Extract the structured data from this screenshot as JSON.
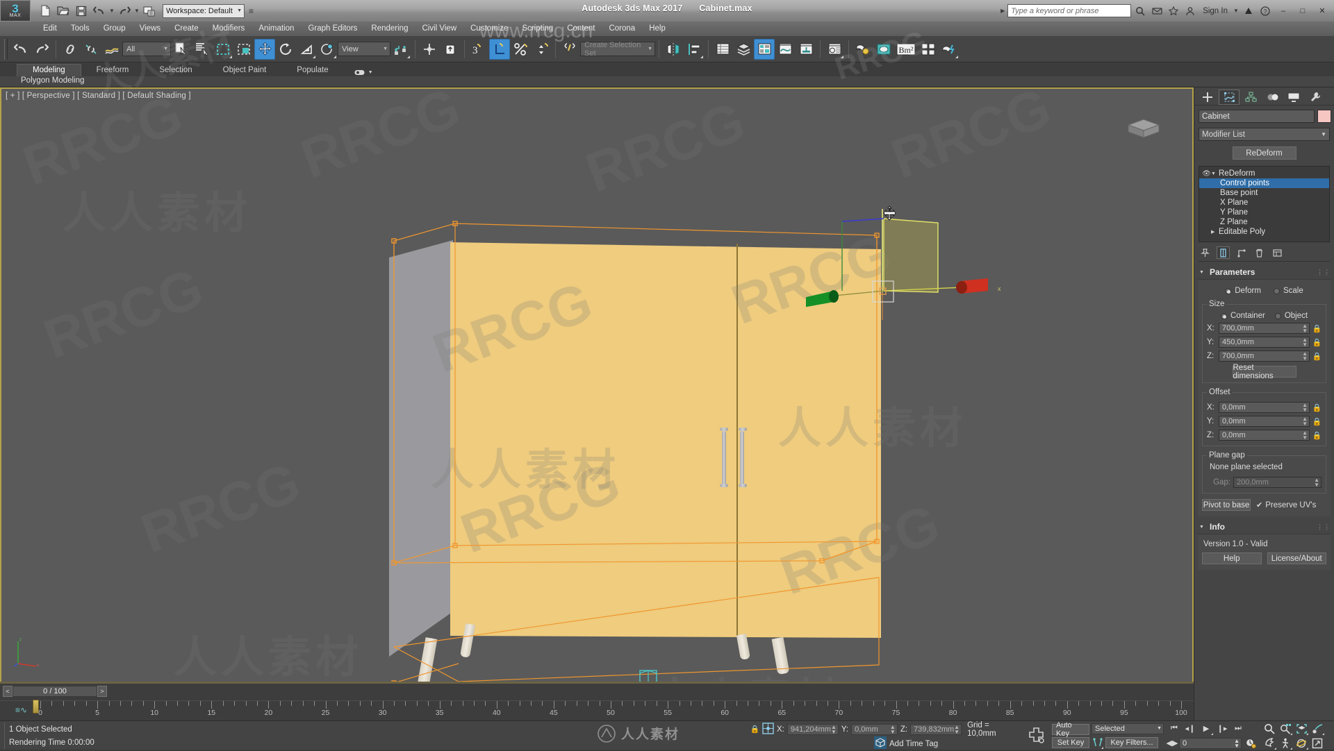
{
  "app": {
    "title_product": "Autodesk 3ds Max 2017",
    "title_file": "Cabinet.max",
    "workspace": "Workspace: Default",
    "search_placeholder": "Type a keyword or phrase",
    "sign_in": "Sign In",
    "logo_big": "3",
    "logo_small": "MAX",
    "window_buttons": [
      "—",
      "❐",
      "✕"
    ]
  },
  "menu": [
    "Edit",
    "Tools",
    "Group",
    "Views",
    "Create",
    "Modifiers",
    "Animation",
    "Graph Editors",
    "Rendering",
    "Civil View",
    "Customize",
    "Scripting",
    "Content",
    "Corona",
    "Help"
  ],
  "toolbar": {
    "selection_filter": "All",
    "reference_coord": "View",
    "selection_set_placeholder": "Create Selection Set",
    "icons": [
      "undo-icon",
      "redo-icon",
      "select-link-icon",
      "unlink-icon",
      "bind-space-warp-icon",
      "select-object-icon",
      "select-by-name-icon",
      "rectangular-select-icon",
      "window-crossing-icon",
      "select-and-move-icon",
      "select-and-rotate-icon",
      "select-and-scale-icon",
      "placement-icon",
      "use-pivot-center-icon",
      "select-and-manipulate-icon",
      "snaps-toggle-icon",
      "angle-snap-icon",
      "percent-snap-icon",
      "spinner-snap-icon",
      "named-selection-sets-icon",
      "mirror-icon",
      "align-icon",
      "layer-manager-icon",
      "scene-explorer-icon",
      "ribbon-toggle-icon",
      "curve-editor-icon",
      "schematic-view-icon",
      "material-editor-icon",
      "render-setup-icon",
      "render-frame-window-icon",
      "render-production-icon",
      "render-bitmap-icon",
      "render-iterative-icon",
      "active-shade-icon"
    ]
  },
  "ribbon": {
    "tabs": [
      "Modeling",
      "Freeform",
      "Selection",
      "Object Paint",
      "Populate"
    ],
    "active_tab": "Modeling",
    "panel_label": "Polygon Modeling"
  },
  "viewport": {
    "label": "[ + ] [ Perspective ] [ Standard ] [ Default Shading ]",
    "cabinet_front_color": "#efcc7e",
    "cabinet_side_color": "#9a9a9e",
    "selection_color": "#f0962e",
    "gizmo": {
      "x_axis_color": "#d03020",
      "y_axis_color": "#1f9b30",
      "z_axis_color": "#e8e87a"
    }
  },
  "command_panel": {
    "tabs": [
      "create-tab-icon",
      "modify-tab-icon",
      "hierarchy-tab-icon",
      "motion-tab-icon",
      "display-tab-icon",
      "utilities-tab-icon"
    ],
    "active_tab_index": 1,
    "object_name": "Cabinet",
    "modifier_list_label": "Modifier List",
    "modifier_button": "ReDeform",
    "stack": [
      {
        "label": "ReDeform",
        "level": 0,
        "selected": false,
        "eye": true,
        "expand": true
      },
      {
        "label": "Control points",
        "level": 1,
        "selected": true
      },
      {
        "label": "Base point",
        "level": 1,
        "selected": false
      },
      {
        "label": "X Plane",
        "level": 1,
        "selected": false
      },
      {
        "label": "Y Plane",
        "level": 1,
        "selected": false
      },
      {
        "label": "Z Plane",
        "level": 1,
        "selected": false
      },
      {
        "label": "Editable Poly",
        "level": 0,
        "selected": false,
        "expand": false
      }
    ],
    "stack_tools": [
      "pin-stack-icon",
      "show-end-result-icon",
      "make-unique-icon",
      "remove-modifier-icon",
      "configure-sets-icon"
    ],
    "parameters": {
      "header": "Parameters",
      "mode_options": [
        "Deform",
        "Scale"
      ],
      "mode_selected": "Deform",
      "size": {
        "legend": "Size",
        "options": [
          "Container",
          "Object"
        ],
        "selected": "Container",
        "x": "700,0mm",
        "y": "450,0mm",
        "z": "700,0mm",
        "reset_button": "Reset dimensions"
      },
      "offset": {
        "legend": "Offset",
        "x": "0,0mm",
        "y": "0,0mm",
        "z": "0,0mm"
      },
      "plane_gap": {
        "legend": "Plane gap",
        "status": "None plane selected",
        "gap_label": "Gap:",
        "gap_value": "200,0mm"
      },
      "pivot_button": "Pivot to base",
      "preserve_uvs_label": "Preserve UV's",
      "preserve_uvs_checked": true
    },
    "info": {
      "header": "Info",
      "version": "Version 1.0 - Valid",
      "help_button": "Help",
      "license_button": "License/About"
    }
  },
  "timeline": {
    "frame_display": "0 / 100",
    "prev_label": "<",
    "next_label": ">",
    "ticks": [
      0,
      5,
      10,
      15,
      20,
      25,
      30,
      35,
      40,
      45,
      50,
      55,
      60,
      65,
      70,
      75,
      80,
      85,
      90,
      95,
      100
    ],
    "current_frame": 0
  },
  "status": {
    "selection": "1 Object Selected",
    "rendering_time": "Rendering Time  0:00:00",
    "coord_x_label": "X:",
    "coord_x": "941,204mm",
    "coord_y_label": "Y:",
    "coord_y": "0,0mm",
    "coord_z_label": "Z:",
    "coord_z": "739,832mm",
    "grid": "Grid = 10,0mm",
    "add_time_tag": "Add Time Tag",
    "auto_key": "Auto Key",
    "set_key": "Set Key",
    "key_mode": "Selected",
    "key_filters": "Key Filters...",
    "key_frame_field": "0"
  },
  "watermarks": {
    "primary": "RRCG",
    "chinese": "人人素材",
    "site": "www.rrcg.cn"
  }
}
